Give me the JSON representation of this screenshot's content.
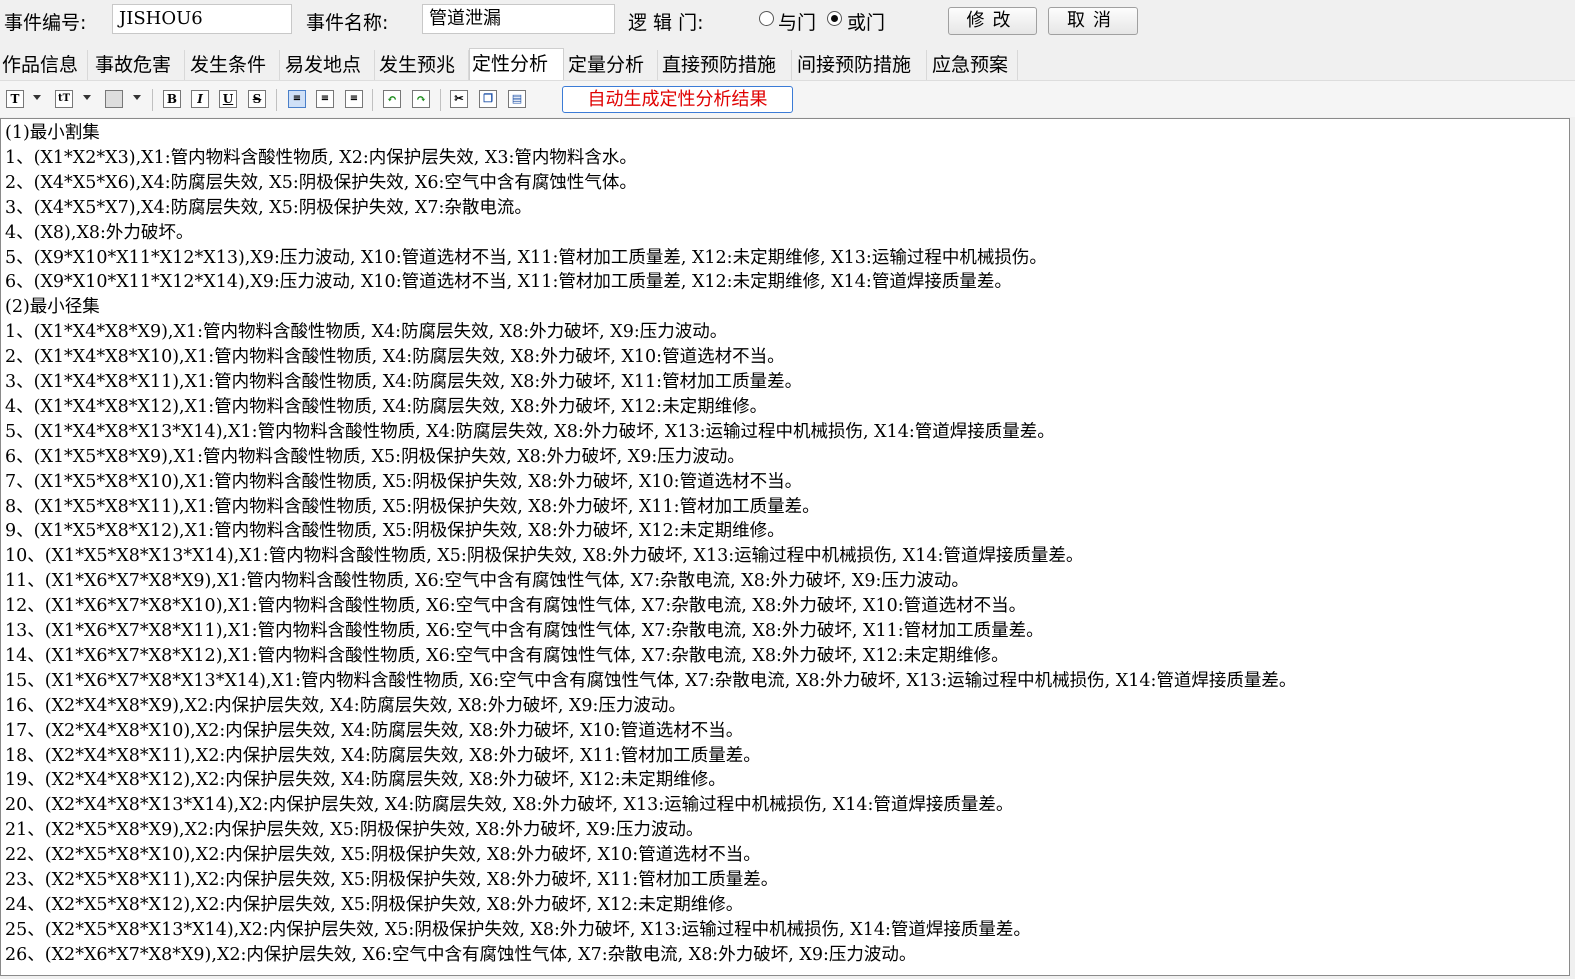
{
  "header": {
    "event_id_label": "事件编号:",
    "event_id_value": "JISHOU6",
    "event_name_label": "事件名称:",
    "event_name_value": "管道泄漏",
    "logic_gate_label": "逻 辑 门:",
    "and_gate_label": "与门",
    "or_gate_label": "或门",
    "selected_gate": "or",
    "modify_label": "修改",
    "cancel_label": "取消"
  },
  "tabs": [
    {
      "label": "作品信息"
    },
    {
      "label": "事故危害"
    },
    {
      "label": "发生条件"
    },
    {
      "label": "易发地点"
    },
    {
      "label": "发生预兆"
    },
    {
      "label": "定性分析",
      "active": true
    },
    {
      "label": "定量分析"
    },
    {
      "label": "直接预防措施"
    },
    {
      "label": "间接预防措施"
    },
    {
      "label": "应急预案"
    }
  ],
  "toolbar": {
    "generate_label": "自动生成定性分析结果",
    "icons": [
      "text-style-icon",
      "font-size-icon",
      "highlight-color-icon",
      "bold-icon",
      "italic-icon",
      "underline-icon",
      "strikethrough-icon",
      "align-left-icon",
      "align-center-icon",
      "align-right-icon",
      "undo-icon",
      "redo-icon",
      "cut-icon",
      "copy-icon",
      "paste-icon"
    ]
  },
  "content": {
    "lines": [
      "(1)最小割集",
      "1、(X1*X2*X3),X1:管内物料含酸性物质, X2:内保护层失效, X3:管内物料含水。",
      "2、(X4*X5*X6),X4:防腐层失效, X5:阴极保护失效, X6:空气中含有腐蚀性气体。",
      "3、(X4*X5*X7),X4:防腐层失效, X5:阴极保护失效, X7:杂散电流。",
      "4、(X8),X8:外力破坏。",
      "5、(X9*X10*X11*X12*X13),X9:压力波动, X10:管道选材不当, X11:管材加工质量差, X12:未定期维修, X13:运输过程中机械损伤。",
      "6、(X9*X10*X11*X12*X14),X9:压力波动, X10:管道选材不当, X11:管材加工质量差, X12:未定期维修, X14:管道焊接质量差。",
      "(2)最小径集",
      "1、(X1*X4*X8*X9),X1:管内物料含酸性物质, X4:防腐层失效, X8:外力破坏, X9:压力波动。",
      "2、(X1*X4*X8*X10),X1:管内物料含酸性物质, X4:防腐层失效, X8:外力破坏, X10:管道选材不当。",
      "3、(X1*X4*X8*X11),X1:管内物料含酸性物质, X4:防腐层失效, X8:外力破坏, X11:管材加工质量差。",
      "4、(X1*X4*X8*X12),X1:管内物料含酸性物质, X4:防腐层失效, X8:外力破坏, X12:未定期维修。",
      "5、(X1*X4*X8*X13*X14),X1:管内物料含酸性物质, X4:防腐层失效, X8:外力破坏, X13:运输过程中机械损伤, X14:管道焊接质量差。",
      "6、(X1*X5*X8*X9),X1:管内物料含酸性物质, X5:阴极保护失效, X8:外力破坏, X9:压力波动。",
      "7、(X1*X5*X8*X10),X1:管内物料含酸性物质, X5:阴极保护失效, X8:外力破坏, X10:管道选材不当。",
      "8、(X1*X5*X8*X11),X1:管内物料含酸性物质, X5:阴极保护失效, X8:外力破坏, X11:管材加工质量差。",
      "9、(X1*X5*X8*X12),X1:管内物料含酸性物质, X5:阴极保护失效, X8:外力破坏, X12:未定期维修。",
      "10、(X1*X5*X8*X13*X14),X1:管内物料含酸性物质, X5:阴极保护失效, X8:外力破坏, X13:运输过程中机械损伤, X14:管道焊接质量差。",
      "11、(X1*X6*X7*X8*X9),X1:管内物料含酸性物质, X6:空气中含有腐蚀性气体, X7:杂散电流, X8:外力破坏, X9:压力波动。",
      "12、(X1*X6*X7*X8*X10),X1:管内物料含酸性物质, X6:空气中含有腐蚀性气体, X7:杂散电流, X8:外力破坏, X10:管道选材不当。",
      "13、(X1*X6*X7*X8*X11),X1:管内物料含酸性物质, X6:空气中含有腐蚀性气体, X7:杂散电流, X8:外力破坏, X11:管材加工质量差。",
      "14、(X1*X6*X7*X8*X12),X1:管内物料含酸性物质, X6:空气中含有腐蚀性气体, X7:杂散电流, X8:外力破坏, X12:未定期维修。",
      "15、(X1*X6*X7*X8*X13*X14),X1:管内物料含酸性物质, X6:空气中含有腐蚀性气体, X7:杂散电流, X8:外力破坏, X13:运输过程中机械损伤, X14:管道焊接质量差。",
      "16、(X2*X4*X8*X9),X2:内保护层失效, X4:防腐层失效, X8:外力破坏, X9:压力波动。",
      "17、(X2*X4*X8*X10),X2:内保护层失效, X4:防腐层失效, X8:外力破坏, X10:管道选材不当。",
      "18、(X2*X4*X8*X11),X2:内保护层失效, X4:防腐层失效, X8:外力破坏, X11:管材加工质量差。",
      "19、(X2*X4*X8*X12),X2:内保护层失效, X4:防腐层失效, X8:外力破坏, X12:未定期维修。",
      "20、(X2*X4*X8*X13*X14),X2:内保护层失效, X4:防腐层失效, X8:外力破坏, X13:运输过程中机械损伤, X14:管道焊接质量差。",
      "21、(X2*X5*X8*X9),X2:内保护层失效, X5:阴极保护失效, X8:外力破坏, X9:压力波动。",
      "22、(X2*X5*X8*X10),X2:内保护层失效, X5:阴极保护失效, X8:外力破坏, X10:管道选材不当。",
      "23、(X2*X5*X8*X11),X2:内保护层失效, X5:阴极保护失效, X8:外力破坏, X11:管材加工质量差。",
      "24、(X2*X5*X8*X12),X2:内保护层失效, X5:阴极保护失效, X8:外力破坏, X12:未定期维修。",
      "25、(X2*X5*X8*X13*X14),X2:内保护层失效, X5:阴极保护失效, X8:外力破坏, X13:运输过程中机械损伤, X14:管道焊接质量差。",
      "26、(X2*X6*X7*X8*X9),X2:内保护层失效, X6:空气中含有腐蚀性气体, X7:杂散电流, X8:外力破坏, X9:压力波动。"
    ]
  },
  "colors": {
    "accent_border": "#3b7bd6",
    "generate_text": "#e00000"
  }
}
